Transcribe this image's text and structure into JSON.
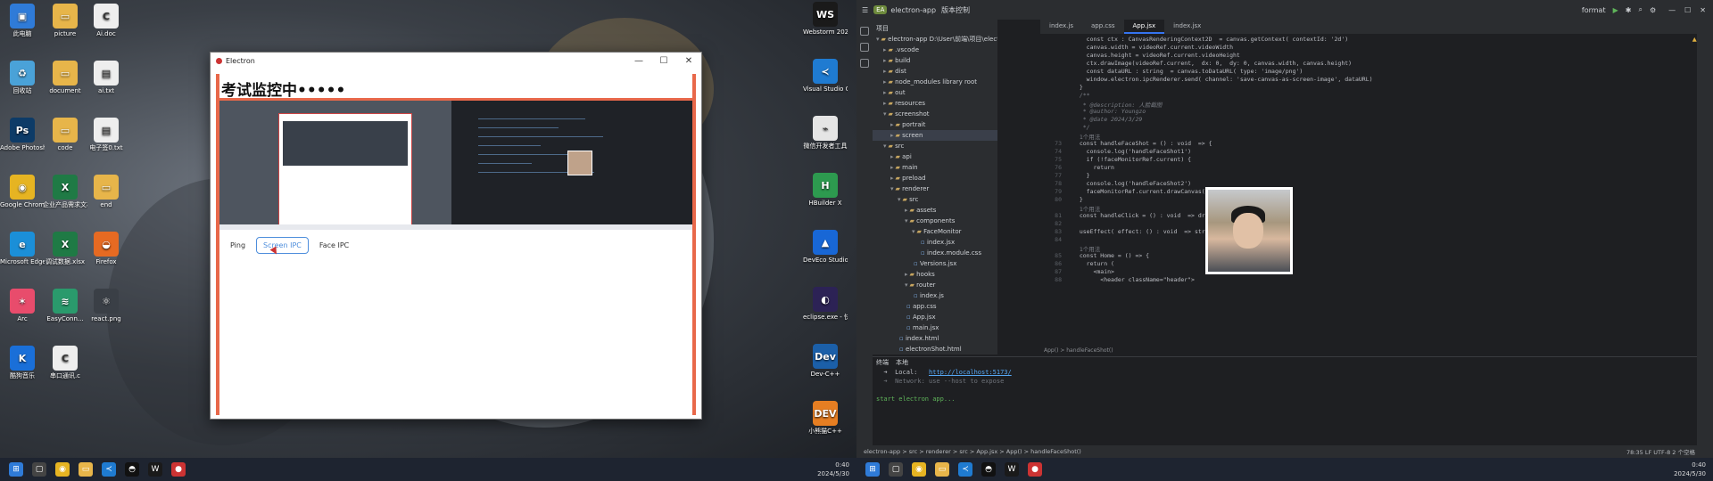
{
  "desktop_icons_left": [
    {
      "label": "此电脑",
      "color": "#2f7bd8",
      "glyph": "▣"
    },
    {
      "label": "picture",
      "color": "#e7b54a",
      "glyph": "▭"
    },
    {
      "label": "Ai.doc",
      "color": "#eeeeee",
      "glyph": "C"
    },
    {
      "label": "回收站",
      "color": "#4aa2d8",
      "glyph": "♻"
    },
    {
      "label": "document",
      "color": "#e7b54a",
      "glyph": "▭"
    },
    {
      "label": "ai.txt",
      "color": "#eeeeee",
      "glyph": "▤"
    },
    {
      "label": "Adobe Photosh...",
      "color": "#0d3b67",
      "glyph": "Ps"
    },
    {
      "label": "code",
      "color": "#e7b54a",
      "glyph": "▭"
    },
    {
      "label": "电子签0.txt",
      "color": "#eeeeee",
      "glyph": "▤"
    },
    {
      "label": "Google Chrome",
      "color": "#e6b422",
      "glyph": "◉"
    },
    {
      "label": "企业产品需求文档.xlsx",
      "color": "#1f7a45",
      "glyph": "X"
    },
    {
      "label": "end",
      "color": "#e7b54a",
      "glyph": "▭"
    },
    {
      "label": "Microsoft Edge",
      "color": "#1b8fd8",
      "glyph": "e"
    },
    {
      "label": "调试数据.xlsx",
      "color": "#1f7a45",
      "glyph": "X"
    },
    {
      "label": "Firefox",
      "color": "#e66a22",
      "glyph": "◒"
    },
    {
      "label": "Arc",
      "color": "#e84c6c",
      "glyph": "✶"
    },
    {
      "label": "EasyConn...",
      "color": "#2a9a6c",
      "glyph": "≋"
    },
    {
      "label": "react.png",
      "color": "#3a3f46",
      "glyph": "⚛"
    },
    {
      "label": "酷狗音乐",
      "color": "#1a6fd8",
      "glyph": "K"
    },
    {
      "label": "串口通讯.c",
      "color": "#eeeeee",
      "glyph": "C"
    }
  ],
  "desktop_icons_right": [
    {
      "label": "Webstorm 2021.3.3",
      "color": "#1a1a1a",
      "glyph": "WS"
    },
    {
      "label": "Visual Studio Code",
      "color": "#1f7bd1",
      "glyph": "≺"
    },
    {
      "label": "微信开发者工具",
      "color": "#e5e5e5",
      "glyph": "⌁"
    },
    {
      "label": "HBuilder X",
      "color": "#2d9a4f",
      "glyph": "H"
    },
    {
      "label": "DevEco Studio",
      "color": "#1867d6",
      "glyph": "▲"
    },
    {
      "label": "eclipse.exe - 快捷方式",
      "color": "#2c2255",
      "glyph": "◐"
    },
    {
      "label": "Dev-C++",
      "color": "#1b5fa8",
      "glyph": "Dev"
    },
    {
      "label": "小熊猫C++",
      "color": "#e67e22",
      "glyph": "DEV"
    }
  ],
  "electron_window": {
    "title": "Electron",
    "heading": "考试监控中•••••",
    "buttons": [
      "Ping",
      "Screen IPC",
      "Face IPC"
    ],
    "active_button": "Screen IPC",
    "controls": {
      "minimize": "—",
      "maximize": "☐",
      "close": "✕"
    },
    "accent": "#e8684a"
  },
  "taskbar_left": {
    "time": "0:40",
    "date": "2024/5/30"
  },
  "ide": {
    "project": "electron-app",
    "project_badge": "EA",
    "vcs": "版本控制",
    "branch": "format",
    "tabs": [
      "index.js",
      "app.css",
      "App.jsx",
      "index.jsx"
    ],
    "active_tab": "App.jsx",
    "tree_header": "项目",
    "tree": [
      {
        "text": "electron-app  D:\\User\\前端\\项目\\electron-exam",
        "kind": "folder",
        "depth": 0,
        "open": true
      },
      {
        "text": ".vscode",
        "kind": "folder",
        "depth": 1
      },
      {
        "text": "build",
        "kind": "folder",
        "depth": 1
      },
      {
        "text": "dist",
        "kind": "folder",
        "depth": 1
      },
      {
        "text": "node_modules  library root",
        "kind": "folder",
        "depth": 1
      },
      {
        "text": "out",
        "kind": "folder",
        "depth": 1
      },
      {
        "text": "resources",
        "kind": "folder",
        "depth": 1
      },
      {
        "text": "screenshot",
        "kind": "folder",
        "depth": 1,
        "open": true
      },
      {
        "text": "portrait",
        "kind": "folder",
        "depth": 2
      },
      {
        "text": "screen",
        "kind": "folder",
        "depth": 2,
        "selected": true
      },
      {
        "text": "src",
        "kind": "folder",
        "depth": 1,
        "open": true
      },
      {
        "text": "api",
        "kind": "folder",
        "depth": 2
      },
      {
        "text": "main",
        "kind": "folder",
        "depth": 2
      },
      {
        "text": "preload",
        "kind": "folder",
        "depth": 2
      },
      {
        "text": "renderer",
        "kind": "folder",
        "depth": 2,
        "open": true
      },
      {
        "text": "src",
        "kind": "folder",
        "depth": 3,
        "open": true
      },
      {
        "text": "assets",
        "kind": "folder",
        "depth": 4
      },
      {
        "text": "components",
        "kind": "folder",
        "depth": 4,
        "open": true
      },
      {
        "text": "FaceMonitor",
        "kind": "folder",
        "depth": 5,
        "open": true
      },
      {
        "text": "index.jsx",
        "kind": "file",
        "depth": 6
      },
      {
        "text": "index.module.css",
        "kind": "file",
        "depth": 6
      },
      {
        "text": "Versions.jsx",
        "kind": "file",
        "depth": 5
      },
      {
        "text": "hooks",
        "kind": "folder",
        "depth": 4
      },
      {
        "text": "router",
        "kind": "folder",
        "depth": 4,
        "open": true
      },
      {
        "text": "index.js",
        "kind": "file",
        "depth": 5
      },
      {
        "text": "app.css",
        "kind": "file",
        "depth": 4
      },
      {
        "text": "App.jsx",
        "kind": "file",
        "depth": 4
      },
      {
        "text": "main.jsx",
        "kind": "file",
        "depth": 4
      },
      {
        "text": "index.html",
        "kind": "file",
        "depth": 3
      },
      {
        "text": "electronShot.html",
        "kind": "file",
        "depth": 3
      }
    ],
    "code_lines": [
      {
        "n": "",
        "t": "    const ctx : CanvasRenderingContext2D  = canvas.getContext( contextId: '2d')"
      },
      {
        "n": "",
        "t": "    canvas.width = videoRef.current.videoWidth"
      },
      {
        "n": "",
        "t": "    canvas.height = videoRef.current.videoHeight"
      },
      {
        "n": "",
        "t": "    ctx.drawImage(videoRef.current,  dx: 0,  dy: 0, canvas.width, canvas.height)"
      },
      {
        "n": "",
        "t": "    const dataURL : string  = canvas.toDataURL( type: 'image/png')"
      },
      {
        "n": "",
        "t": "    window.electron.ipcRenderer.send( channel: 'save-canvas-as-screen-image', dataURL)"
      },
      {
        "n": "",
        "t": "  }"
      },
      {
        "n": "",
        "t": "  /**"
      },
      {
        "n": "",
        "t": "   * @description: 人脸截图"
      },
      {
        "n": "",
        "t": "   * @author: Youngzo"
      },
      {
        "n": "",
        "t": "   * @date 2024/3/29"
      },
      {
        "n": "",
        "t": "   */"
      },
      {
        "n": "",
        "t": "  1个用法"
      },
      {
        "n": "73",
        "t": "  const handleFaceShot = () : void  => {"
      },
      {
        "n": "74",
        "t": "    console.log('handleFaceShot1')"
      },
      {
        "n": "75",
        "t": "    if (!faceMonitorRef.current) {"
      },
      {
        "n": "76",
        "t": "      return"
      },
      {
        "n": "77",
        "t": "    }"
      },
      {
        "n": "78",
        "t": "    console.log('handleFaceShot2')"
      },
      {
        "n": "79",
        "t": "    faceMonitorRef.current.drawCanvas()"
      },
      {
        "n": "80",
        "t": "  }"
      },
      {
        "n": "",
        "t": "  1个用法"
      },
      {
        "n": "81",
        "t": "  const handleClick = () : void  => drawCanvas()"
      },
      {
        "n": "82",
        "t": ""
      },
      {
        "n": "83",
        "t": "  useEffect( effect: () : void  => streamInit(),  deps: [])"
      },
      {
        "n": "84",
        "t": ""
      },
      {
        "n": "",
        "t": "  1个用法"
      },
      {
        "n": "85",
        "t": "  const Home = () => {"
      },
      {
        "n": "86",
        "t": "    return ("
      },
      {
        "n": "87",
        "t": "      <main>"
      },
      {
        "n": "88",
        "t": "        <header className=\"header\">"
      }
    ],
    "breadcrumb_bottom": "App()  >  handleFaceShot()",
    "terminal_tabs": [
      "终端",
      "本地"
    ],
    "terminal_lines": [
      {
        "prefix": "  ➜  Local:   ",
        "link": "http://localhost:5173/"
      },
      {
        "prefix": "  ➜  Network: use --host to expose",
        "link": ""
      },
      {
        "prefix": "",
        "link": ""
      },
      {
        "prefix": "start electron app...",
        "link": ""
      }
    ],
    "status_path": "electron-app  >  src  >  renderer  >  src  >  App.jsx  >  App()  >  handleFaceShot()",
    "status_right": "78:35   LF   UTF-8   2 个空格",
    "warning_count": "▲ 3"
  },
  "taskbar_right": {
    "time": "0:40",
    "date": "2024/5/30"
  }
}
